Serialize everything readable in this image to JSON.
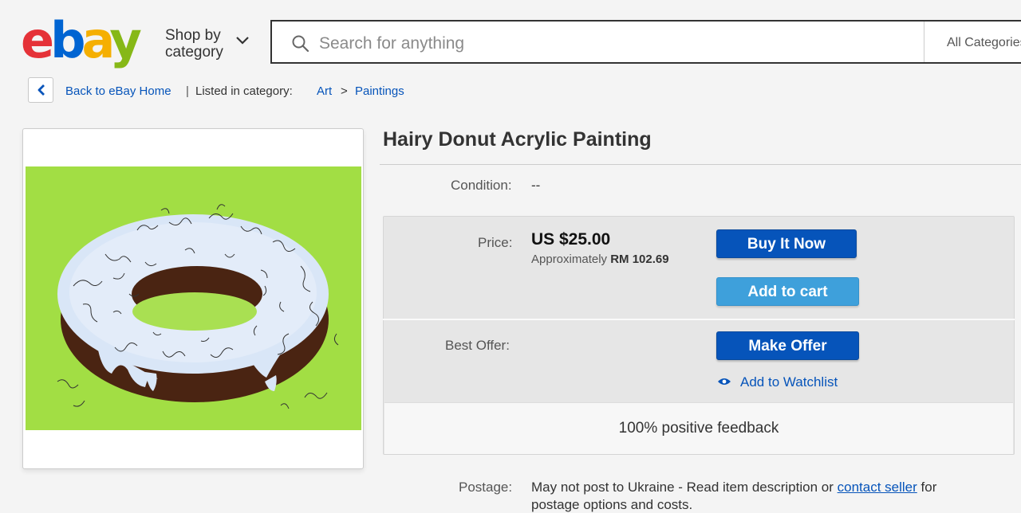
{
  "header": {
    "logo_letters": [
      "e",
      "b",
      "a",
      "y"
    ],
    "shop_by_line1": "Shop by",
    "shop_by_line2": "category",
    "search_placeholder": "Search for anything",
    "category_select": "All Categories"
  },
  "breadcrumb": {
    "back_label": "Back to eBay Home",
    "separator": "|",
    "listed_in": "Listed in category:",
    "category": "Art",
    "arrow": ">",
    "subcategory": "Paintings"
  },
  "item": {
    "title": "Hairy Donut Acrylic Painting",
    "condition_label": "Condition:",
    "condition_value": "--",
    "price_label": "Price:",
    "price_value": "US $25.00",
    "approx_prefix": "Approximately",
    "approx_value": "RM 102.69",
    "buy_it_now": "Buy It Now",
    "add_to_cart": "Add to cart",
    "best_offer_label": "Best Offer:",
    "make_offer": "Make Offer",
    "add_to_watchlist": "Add to Watchlist",
    "feedback": "100% positive feedback",
    "postage_label": "Postage:",
    "postage_text": "May not post to Ukraine - Read item description or",
    "contact_seller": "contact seller",
    "postage_suffix": "for",
    "postage_continuation": "postage options and costs."
  },
  "colors": {
    "link": "#0654ba",
    "primary_button": "#0654ba",
    "secondary_button": "#3ea0db",
    "painting_background": "#9ddb3c",
    "donut_icing": "#d9e6f7",
    "donut_base": "#4a2412"
  }
}
